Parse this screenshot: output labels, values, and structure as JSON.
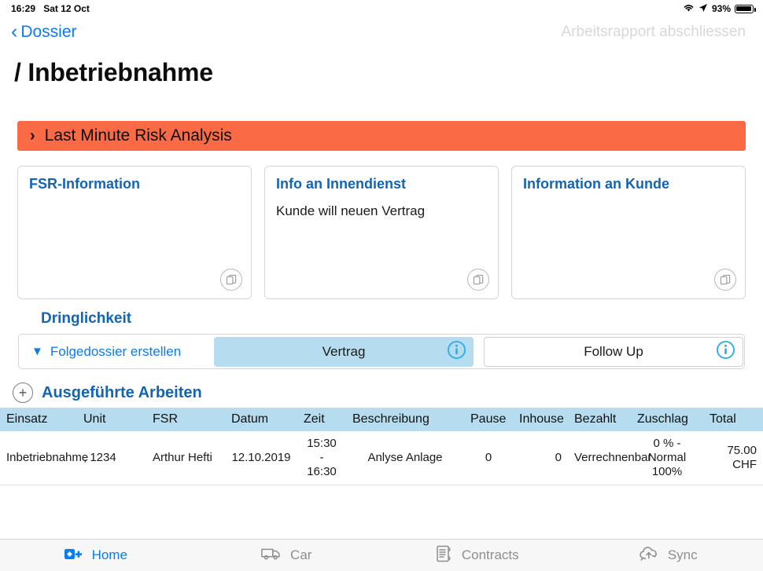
{
  "statusbar": {
    "time": "16:29",
    "date": "Sat 12 Oct",
    "battery_percent": "93%",
    "wifi_icon": "wifi-icon",
    "location_icon": "location-arrow-icon",
    "battery_icon": "battery-icon"
  },
  "navbar": {
    "back_label": "Dossier",
    "back_icon": "chevron-left-icon",
    "action_label": "Arbeitsrapport abschliessen"
  },
  "page": {
    "title": "/ Inbetriebnahme"
  },
  "risk_banner": {
    "label": "Last Minute Risk Analysis",
    "icon": "chevron-right-icon",
    "color": "#f96a45"
  },
  "cards": [
    {
      "title": "FSR-Information",
      "body": "",
      "copy_icon": "copy-icon"
    },
    {
      "title": "Info an Innendienst",
      "body": "Kunde will neuen Vertrag",
      "copy_icon": "copy-icon"
    },
    {
      "title": "Information an Kunde",
      "body": "",
      "copy_icon": "copy-icon"
    }
  ],
  "urgency": {
    "title": "Dringlichkeit",
    "follow_dossier_label": "Folgedossier erstellen",
    "follow_dossier_icon": "chevron-down-icon",
    "options": [
      {
        "label": "Vertrag",
        "selected": true,
        "info_icon": "info-circle-icon"
      },
      {
        "label": "Follow Up",
        "selected": false,
        "info_icon": "info-circle-icon"
      }
    ],
    "selected_color": "#b6dcf0"
  },
  "works": {
    "title": "Ausgeführte Arbeiten",
    "add_icon": "plus-circle-icon",
    "columns": [
      "Einsatz",
      "Unit",
      "FSR",
      "Datum",
      "Zeit",
      "Beschreibung",
      "Pause",
      "Inhouse",
      "Bezahlt",
      "Zuschlag",
      "Total"
    ],
    "rows": [
      {
        "einsatz": "Inbetriebnahme",
        "unit": ", 1234",
        "fsr": "Arthur Hefti",
        "datum": "12.10.2019",
        "zeit": "15:30 - 16:30",
        "beschreibung": "Anlyse Anlage",
        "pause": "0",
        "inhouse": "0",
        "bezahlt": "Verrechnenbar",
        "zuschlag": "0 % - Normal 100%",
        "total": "75.00 CHF"
      }
    ]
  },
  "tabbar": {
    "items": [
      {
        "label": "Home",
        "icon": "home-add-icon",
        "active": true
      },
      {
        "label": "Car",
        "icon": "car-icon",
        "active": false
      },
      {
        "label": "Contracts",
        "icon": "contracts-icon",
        "active": false
      },
      {
        "label": "Sync",
        "icon": "sync-cloud-icon",
        "active": false
      }
    ]
  }
}
